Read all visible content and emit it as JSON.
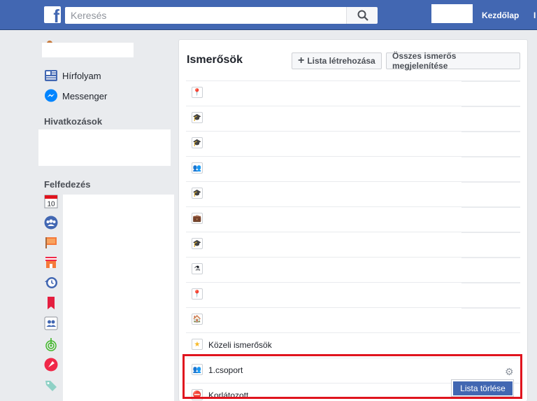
{
  "topbar": {
    "logo_letter": "f",
    "search_placeholder": "Keresés",
    "home_label": "Kezdőlap",
    "cut_label": "I"
  },
  "sidebar": {
    "feed_label": "Hírfolyam",
    "messenger_label": "Messenger",
    "shortcuts_title": "Hivatkozások",
    "explore_title": "Felfedezés",
    "calendar_day": "10",
    "explore_icons": [
      "calendar-icon",
      "groups-icon",
      "pages-flag-icon",
      "marketplace-icon",
      "memories-icon",
      "saved-bookmark-icon",
      "friend-lists-icon",
      "nearby-wifi-icon",
      "fundraiser-rocket-icon",
      "offers-tag-icon"
    ]
  },
  "main": {
    "title": "Ismerősök",
    "create_list_label": "Lista létrehozása",
    "show_all_label": "Összes ismerős megjelenítése",
    "rows": [
      {
        "icon": "location-pin-icon",
        "glyph": "📍",
        "label": ""
      },
      {
        "icon": "graduation-cap-icon",
        "glyph": "🎓",
        "label": ""
      },
      {
        "icon": "graduation-cap-icon",
        "glyph": "🎓",
        "label": ""
      },
      {
        "icon": "people-icon",
        "glyph": "👥",
        "label": ""
      },
      {
        "icon": "graduation-cap-icon",
        "glyph": "🎓",
        "label": ""
      },
      {
        "icon": "briefcase-icon",
        "glyph": "💼",
        "label": ""
      },
      {
        "icon": "graduation-cap-icon",
        "glyph": "🎓",
        "label": ""
      },
      {
        "icon": "flask-icon",
        "glyph": "⚗",
        "label": ""
      },
      {
        "icon": "location-pin-icon",
        "glyph": "📍",
        "label": ""
      },
      {
        "icon": "home-icon",
        "glyph": "🏠",
        "label": ""
      },
      {
        "icon": "star-icon",
        "glyph": "★",
        "label": "Közeli ismerősök"
      },
      {
        "icon": "people-icon",
        "glyph": "👥",
        "label": "1.csoport"
      },
      {
        "icon": "restricted-icon",
        "glyph": "⛔",
        "label": "Korlátozott"
      }
    ],
    "delete_list_label": "Lista törlése"
  },
  "colors": {
    "brand": "#4267b2",
    "highlight": "#e0141e"
  }
}
